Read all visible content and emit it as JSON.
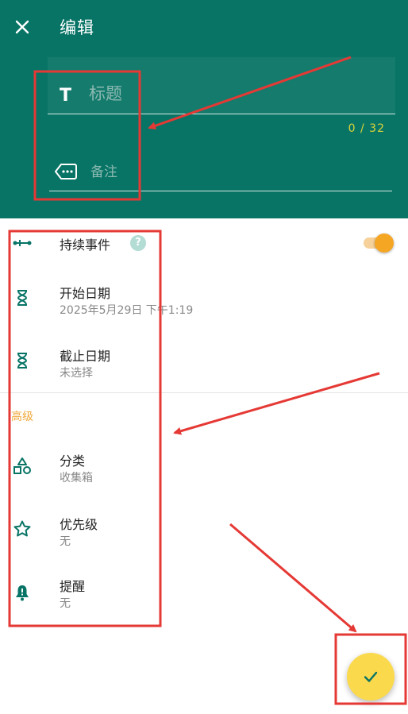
{
  "header": {
    "title": "编辑",
    "title_placeholder": "标题",
    "counter": "0 / 32",
    "note_placeholder": "备注"
  },
  "list": {
    "continuous": {
      "label": "持续事件",
      "help": "?",
      "enabled": true
    },
    "start_date": {
      "label": "开始日期",
      "value": "2025年5月29日 下午1:19"
    },
    "end_date": {
      "label": "截止日期",
      "value": "未选择"
    },
    "advanced_label": "高级",
    "category": {
      "label": "分类",
      "value": "收集箱"
    },
    "priority": {
      "label": "优先级",
      "value": "无"
    },
    "reminder": {
      "label": "提醒",
      "value": "无"
    }
  },
  "colors": {
    "header_bg": "#087466",
    "accent": "#f5a623",
    "fab": "#fbd94c",
    "annotation": "#e53935"
  },
  "icons": {
    "close": "close-icon",
    "title": "text-t-icon",
    "note": "tag-icon",
    "continuous": "timeline-icon",
    "start": "hourglass-icon",
    "end": "hourglass-icon",
    "category": "shapes-icon",
    "priority": "star-icon",
    "reminder": "bell-icon",
    "fab": "check-icon"
  }
}
